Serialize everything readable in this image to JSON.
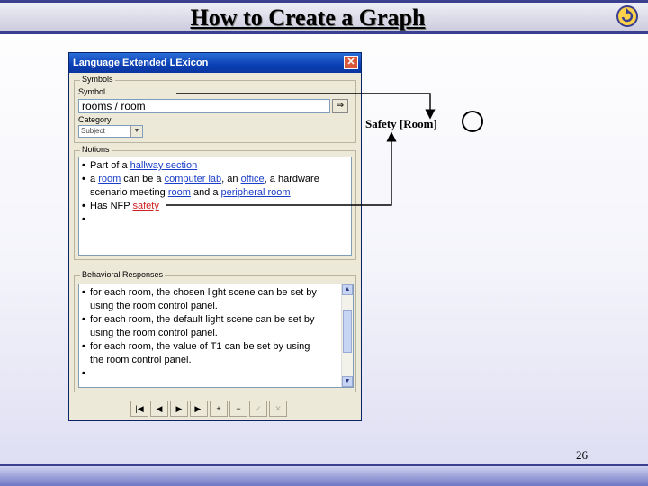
{
  "slide": {
    "title": "How to Create a Graph",
    "page_number": "26",
    "logo_icon": "refresh-logo-icon"
  },
  "window": {
    "title": "Language Extended LExicon",
    "close_glyph": "✕",
    "symbols_group": "Symbols",
    "symbol_label": "Symbol",
    "symbol_value": "rooms / room",
    "symbol_button_glyph": "⇒",
    "category_label": "Category",
    "category_value": "Subject",
    "notions_group": "Notions",
    "notions": [
      {
        "parts": [
          {
            "t": "Part of a ",
            "c": ""
          },
          {
            "t": "hallway section",
            "c": "lnk"
          }
        ]
      },
      {
        "parts": [
          {
            "t": "a ",
            "c": ""
          },
          {
            "t": "room",
            "c": "lnk"
          },
          {
            "t": " can be a ",
            "c": ""
          },
          {
            "t": "computer lab",
            "c": "lnk"
          },
          {
            "t": ", an ",
            "c": ""
          },
          {
            "t": "office",
            "c": "lnk"
          },
          {
            "t": ", a hardware",
            "c": ""
          }
        ]
      },
      {
        "parts": [
          {
            "t": "scenario meeting ",
            "c": ""
          },
          {
            "t": "room",
            "c": "lnk"
          },
          {
            "t": " and a ",
            "c": ""
          },
          {
            "t": "peripheral room",
            "c": "lnk"
          }
        ],
        "continuation": true
      },
      {
        "parts": [
          {
            "t": "Has NFP ",
            "c": ""
          },
          {
            "t": "safety",
            "c": "lnk-red"
          }
        ]
      },
      {
        "parts": [
          {
            "t": "",
            "c": ""
          }
        ]
      }
    ],
    "responses_group": "Behavioral Responses",
    "responses": [
      {
        "text": "for each room, the chosen light scene can be set by"
      },
      {
        "text": "using the room control panel.",
        "continuation": true
      },
      {
        "text": "for each room, the default light scene can be set by"
      },
      {
        "text": "using the room control panel.",
        "continuation": true
      },
      {
        "text": "for each room, the value of T1 can be set by using"
      },
      {
        "text": "the room control panel.",
        "continuation": true
      },
      {
        "text": ""
      }
    ],
    "nav_buttons": [
      {
        "name": "first-record-button",
        "glyph": "|◀",
        "disabled": false
      },
      {
        "name": "previous-record-button",
        "glyph": "◀",
        "disabled": false
      },
      {
        "name": "next-record-button",
        "glyph": "▶",
        "disabled": false
      },
      {
        "name": "last-record-button",
        "glyph": "▶|",
        "disabled": false
      },
      {
        "name": "add-record-button",
        "glyph": "+",
        "disabled": false
      },
      {
        "name": "delete-record-button",
        "glyph": "−",
        "disabled": false
      },
      {
        "name": "confirm-button",
        "glyph": "✓",
        "disabled": true
      },
      {
        "name": "cancel-button",
        "glyph": "✕",
        "disabled": true
      }
    ]
  },
  "graph": {
    "node_label": "Safety [Room]"
  },
  "colors": {
    "title_bar": "#2a6ed8",
    "link": "#1a3ec8",
    "link_red": "#d02020",
    "slide_rule": "#3a3f8f"
  }
}
